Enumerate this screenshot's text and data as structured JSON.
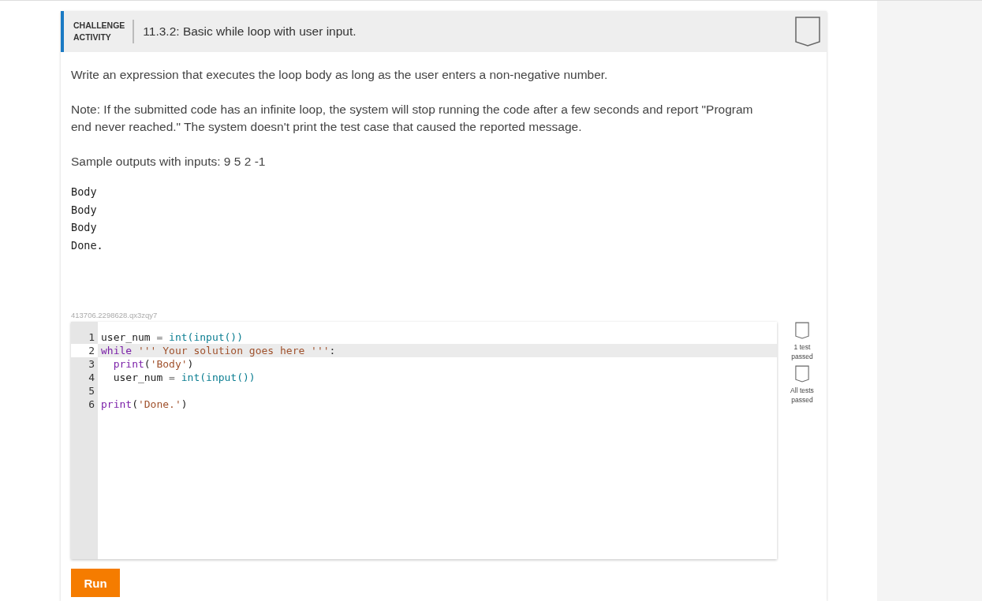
{
  "header": {
    "label_lines": [
      "CHALLENGE",
      "ACTIVITY"
    ],
    "title": "11.3.2: Basic while loop with user input.",
    "completed": false
  },
  "instructions": [
    "Write an expression that executes the loop body as long as the user enters a non-negative number.",
    "Note: If the submitted code has an infinite loop, the system will stop running the code after a few seconds and report \"Program end never reached.\" The system doesn't print the test case that caused the reported message.",
    "Sample outputs with inputs: 9 5 2 -1"
  ],
  "sample_output": [
    "Body",
    "Body",
    "Body",
    "Done."
  ],
  "editor": {
    "id": "413706.2298628.qx3zqy7",
    "lines": [
      {
        "number": "1",
        "active": false,
        "tokens": [
          {
            "kind": "plain",
            "text": "user_num "
          },
          {
            "kind": "op",
            "text": "="
          },
          {
            "kind": "builtin",
            "text": " int(input())"
          }
        ]
      },
      {
        "number": "2",
        "active": true,
        "tokens": [
          {
            "kind": "keyword",
            "text": "while "
          },
          {
            "kind": "string",
            "text": "''' Your solution goes here '''"
          },
          {
            "kind": "plain",
            "text": ":"
          }
        ]
      },
      {
        "number": "3",
        "active": false,
        "tokens": [
          {
            "kind": "keyword",
            "text": "  print"
          },
          {
            "kind": "plain",
            "text": "("
          },
          {
            "kind": "string",
            "text": "'Body'"
          },
          {
            "kind": "plain",
            "text": ")"
          }
        ]
      },
      {
        "number": "4",
        "active": false,
        "tokens": [
          {
            "kind": "plain",
            "text": "  user_num "
          },
          {
            "kind": "op",
            "text": "="
          },
          {
            "kind": "builtin",
            "text": " int(input())"
          }
        ]
      },
      {
        "number": "5",
        "active": false
      },
      {
        "number": "6",
        "active": false,
        "tokens": [
          {
            "kind": "keyword",
            "text": "print"
          },
          {
            "kind": "plain",
            "text": "("
          },
          {
            "kind": "string",
            "text": "'Done.'"
          },
          {
            "kind": "plain",
            "text": ")"
          }
        ]
      }
    ]
  },
  "tests": [
    {
      "lines": [
        "1 test",
        "passed"
      ],
      "completed": false
    },
    {
      "lines": [
        "All tests",
        "passed"
      ],
      "completed": false
    }
  ],
  "run_button": "Run"
}
